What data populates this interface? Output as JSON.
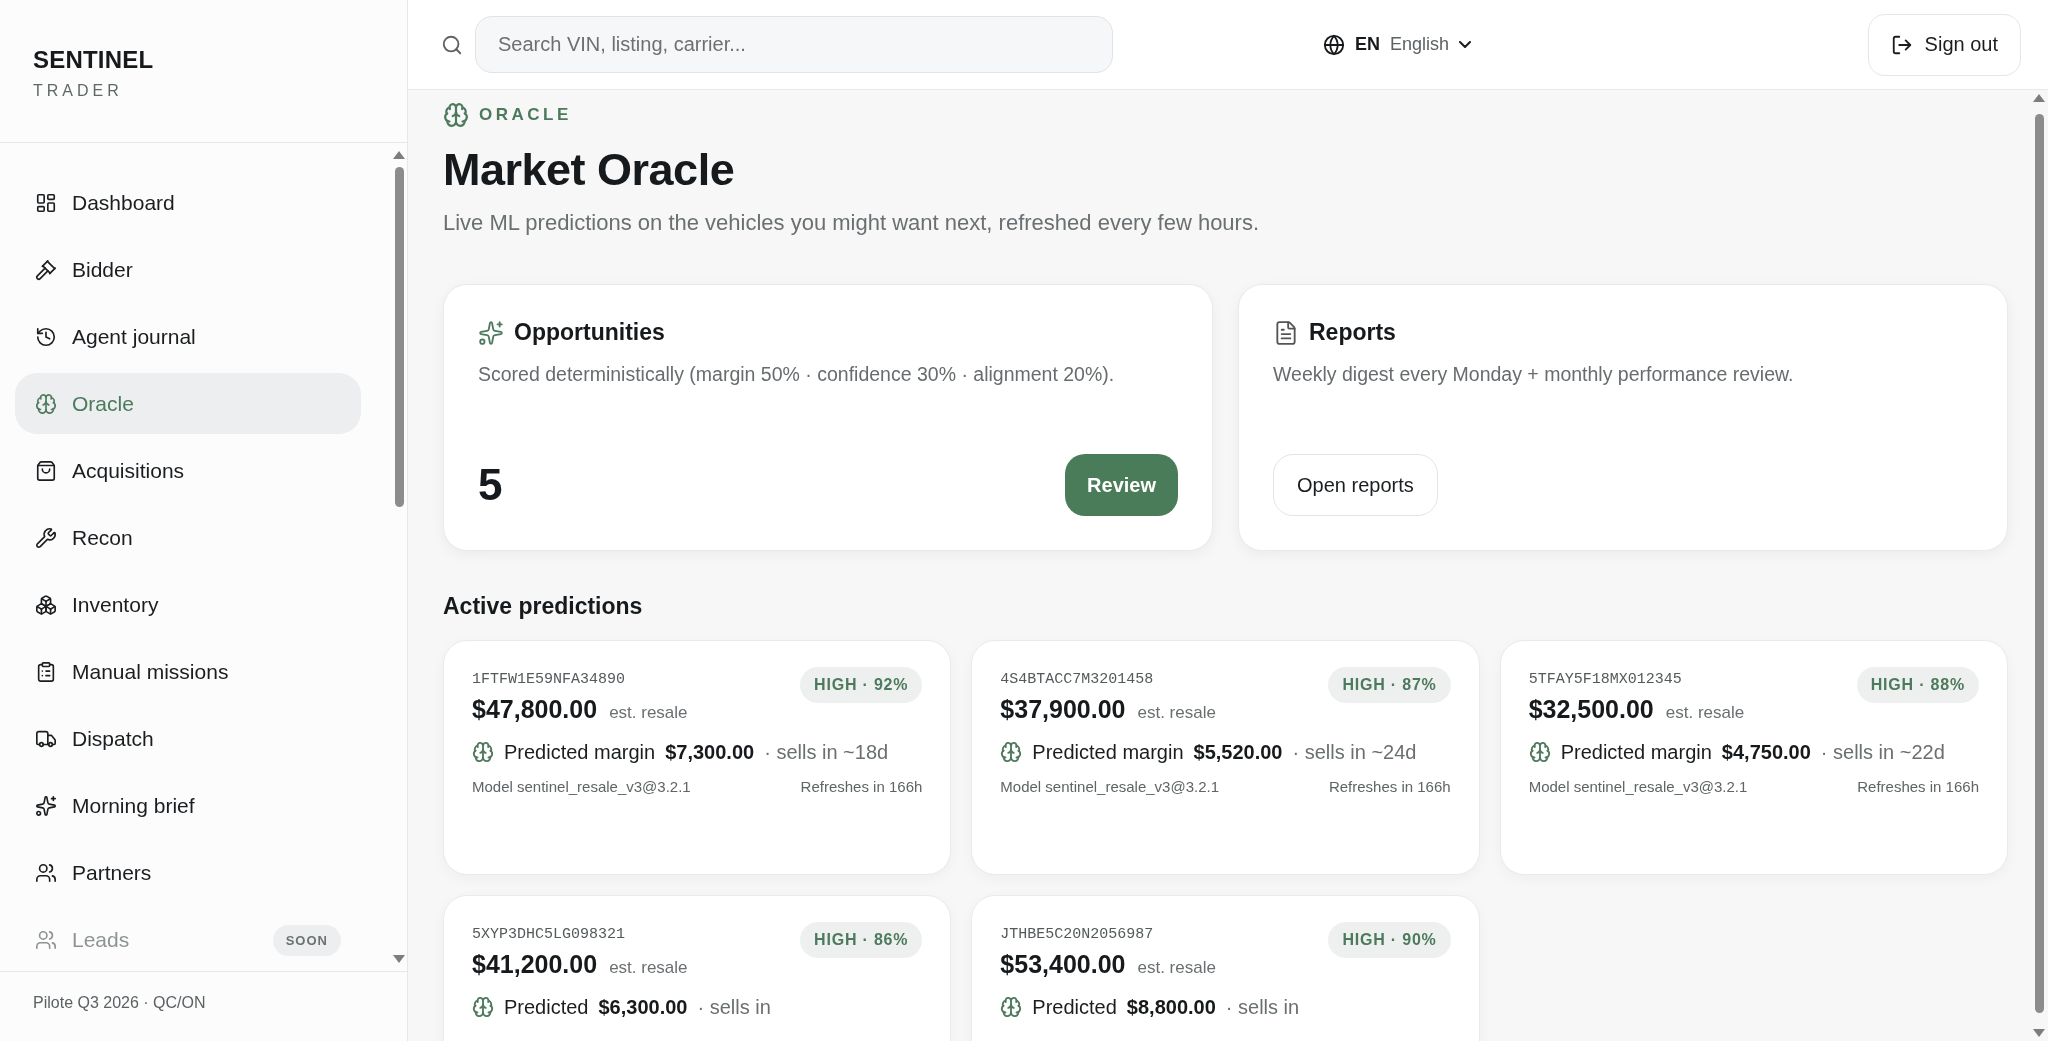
{
  "brand": {
    "name": "SENTINEL",
    "tagline": "TRADER"
  },
  "nav": [
    {
      "label": "Dashboard",
      "selected": false,
      "disabled": false
    },
    {
      "label": "Bidder",
      "selected": false,
      "disabled": false
    },
    {
      "label": "Agent journal",
      "selected": false,
      "disabled": false
    },
    {
      "label": "Oracle",
      "selected": true,
      "disabled": false
    },
    {
      "label": "Acquisitions",
      "selected": false,
      "disabled": false
    },
    {
      "label": "Recon",
      "selected": false,
      "disabled": false
    },
    {
      "label": "Inventory",
      "selected": false,
      "disabled": false
    },
    {
      "label": "Manual missions",
      "selected": false,
      "disabled": false
    },
    {
      "label": "Dispatch",
      "selected": false,
      "disabled": false
    },
    {
      "label": "Morning brief",
      "selected": false,
      "disabled": false
    },
    {
      "label": "Partners",
      "selected": false,
      "disabled": false
    },
    {
      "label": "Leads",
      "selected": false,
      "disabled": true,
      "badge": "SOON"
    }
  ],
  "sidebar_footer": "Pilote Q3 2026 · QC/ON",
  "topbar": {
    "search": {
      "placeholder": "Search VIN, listing, carrier..."
    },
    "language": {
      "code": "EN",
      "name": "English"
    },
    "sign_out": "Sign out"
  },
  "page": {
    "eyebrow": "ORACLE",
    "title": "Market Oracle",
    "subtitle": "Live ML predictions on the vehicles you might want next, refreshed every few hours."
  },
  "cards": [
    {
      "kind": "count",
      "title": "Opportunities",
      "description": "Scored deterministically (margin 50% · confidence 30% · alignment 20%).",
      "value": "5",
      "button": "Review"
    },
    {
      "kind": "link",
      "title": "Reports",
      "description": "Weekly digest every Monday + monthly performance review.",
      "button": "Open reports"
    }
  ],
  "predictions_title": "Active predictions",
  "predictions": [
    {
      "vin": "1FTFW1E59NFA34890",
      "confidence": "HIGH · 92%",
      "price": "$47,800.00",
      "price_note": "est. resale",
      "margin_label": "Predicted margin",
      "margin": "$7,300.00",
      "sells": "· sells in ~18d",
      "model": "Model sentinel_resale_v3@3.2.1",
      "refresh": "Refreshes in 166h"
    },
    {
      "vin": "4S4BTACC7M3201458",
      "confidence": "HIGH · 87%",
      "price": "$37,900.00",
      "price_note": "est. resale",
      "margin_label": "Predicted margin",
      "margin": "$5,520.00",
      "sells": "· sells in ~24d",
      "model": "Model sentinel_resale_v3@3.2.1",
      "refresh": "Refreshes in 166h"
    },
    {
      "vin": "5TFAY5F18MX012345",
      "confidence": "HIGH · 88%",
      "price": "$32,500.00",
      "price_note": "est. resale",
      "margin_label": "Predicted margin",
      "margin": "$4,750.00",
      "sells": "· sells in ~22d",
      "model": "Model sentinel_resale_v3@3.2.1",
      "refresh": "Refreshes in 166h"
    },
    {
      "vin": "5XYP3DHC5LG098321",
      "confidence": "HIGH · 86%",
      "price": "$41,200.00",
      "price_note": "est. resale",
      "margin_label": "Predicted",
      "margin": "$6,300.00",
      "sells": "· sells in"
    },
    {
      "vin": "JTHBE5C20N2056987",
      "confidence": "HIGH · 90%",
      "price": "$53,400.00",
      "price_note": "est. resale",
      "margin_label": "Predicted",
      "margin": "$8,800.00",
      "sells": "· sells in"
    }
  ]
}
